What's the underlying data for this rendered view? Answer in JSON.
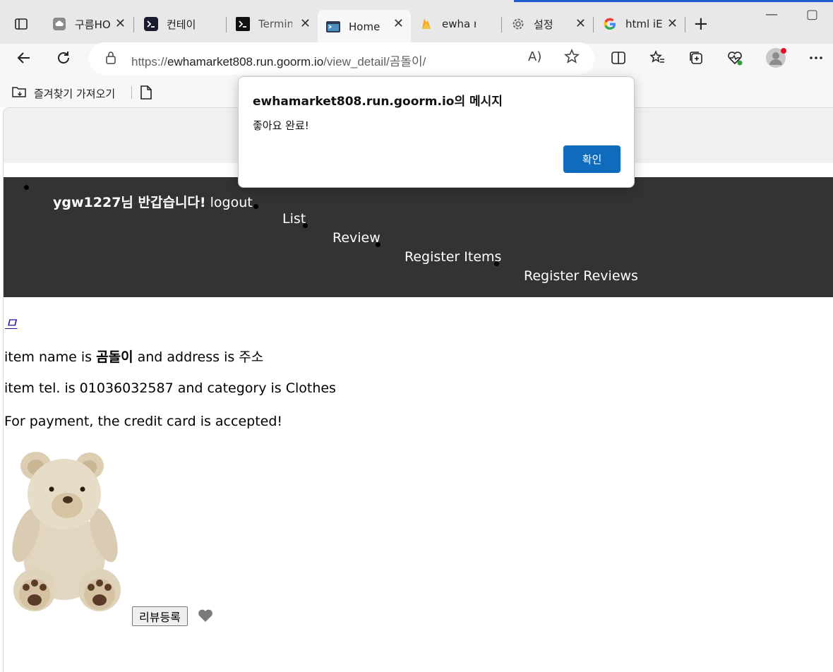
{
  "browser": {
    "tabs": [
      {
        "title": "구름HO",
        "icon": "cloud-icon"
      },
      {
        "title": "컨테이",
        "icon": "terminal-icon"
      },
      {
        "title": "Termina",
        "icon": "terminal-icon"
      },
      {
        "title": "Home",
        "icon": "page-icon",
        "active": true
      },
      {
        "title": "ewha m",
        "icon": "firebase-icon"
      },
      {
        "title": "설정",
        "icon": "gear-icon"
      },
      {
        "title": "html iE",
        "icon": "google-icon"
      }
    ],
    "close_glyph": "✕",
    "new_tab_glyph": "+",
    "minimize_glyph": "—",
    "maximize_glyph": "▢",
    "url_prefix": "https://",
    "url_host": "ewhamarket808.run.goorm.io",
    "url_path": "/view_detail/곰돌이/",
    "read_aloud_glyph": "A)",
    "bookmark_label": "즐겨찾기 가져오기",
    "accent_color": "#1f5fd1"
  },
  "page": {
    "nav": {
      "greeting": "ygw1227님 반갑습니다!",
      "logout": "logout",
      "list": "List",
      "review": "Review",
      "register_items": "Register Items",
      "register_reviews": "Register Reviews",
      "bg_color": "#333333"
    },
    "item_link": "ㅁ",
    "name_line": {
      "prefix": "item name is ",
      "name": "곰돌이",
      "middle": " and address is ",
      "address": "주소"
    },
    "tel_line": "item tel. is 01036032587 and category is Clothes",
    "payment_line": "For payment, the credit card is accepted!",
    "review_button": "리뷰등록"
  },
  "dialog": {
    "title": "ewhamarket808.run.goorm.io의 메시지",
    "message": "좋아요 완료!",
    "ok_label": "확인",
    "ok_color": "#0f6cbd"
  }
}
